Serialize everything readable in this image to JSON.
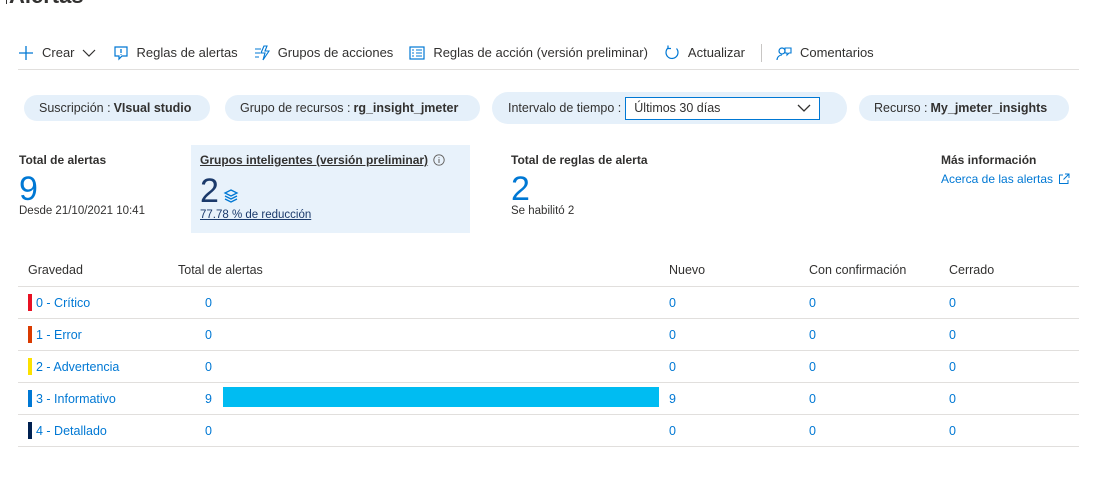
{
  "page": {
    "title": "Alertas"
  },
  "toolbar": {
    "create": "Crear",
    "alert_rules": "Reglas de alertas",
    "action_groups": "Grupos de acciones",
    "action_rules": "Reglas de acción (versión preliminar)",
    "refresh": "Actualizar",
    "feedback": "Comentarios"
  },
  "filters": {
    "subscription": {
      "label": "Suscripción :",
      "value": "VIsual studio"
    },
    "resource_group": {
      "label": "Grupo de recursos :",
      "value": "rg_insight_jmeter"
    },
    "time": {
      "label": "Intervalo de tiempo :",
      "value": "Últimos 30 días"
    },
    "resource": {
      "label": "Recurso :",
      "value": "My_jmeter_insights"
    }
  },
  "stats": {
    "total_alerts": {
      "label": "Total de alertas",
      "value": "9",
      "sub": "Desde 21/10/2021 10:41"
    },
    "smart_groups": {
      "label": "Grupos inteligentes (versión preliminar)",
      "value": "2",
      "sub": "77.78 % de reducción"
    },
    "total_rules": {
      "label": "Total de reglas de alerta",
      "value": "2",
      "sub": "Se habilitó 2"
    },
    "more_info": {
      "label": "Más información",
      "link": "Acerca de las alertas"
    }
  },
  "grid": {
    "headers": [
      "Gravedad",
      "Total de alertas",
      "Nuevo",
      "Con confirmación",
      "Cerrado"
    ],
    "max_total": 9,
    "rows": [
      {
        "severity": "0 - Crítico",
        "color": "#e81123",
        "total": "0",
        "new": "0",
        "ack": "0",
        "closed": "0"
      },
      {
        "severity": "1 - Error",
        "color": "#da3b01",
        "total": "0",
        "new": "0",
        "ack": "0",
        "closed": "0"
      },
      {
        "severity": "2 - Advertencia",
        "color": "#fce100",
        "total": "0",
        "new": "0",
        "ack": "0",
        "closed": "0"
      },
      {
        "severity": "3 - Informativo",
        "color": "#0078d4",
        "total": "9",
        "new": "9",
        "ack": "0",
        "closed": "0"
      },
      {
        "severity": "4 - Detallado",
        "color": "#002050",
        "total": "0",
        "new": "0",
        "ack": "0",
        "closed": "0"
      }
    ]
  },
  "colors": {
    "accent": "#0078d4",
    "bar": "#00bcf2",
    "pill": "#e5f0fa"
  }
}
